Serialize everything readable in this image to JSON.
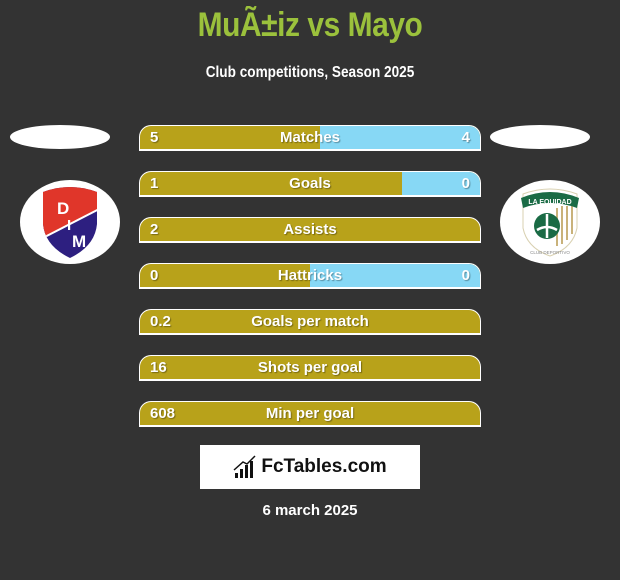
{
  "header": {
    "title": "MuÃ±iz vs Mayo",
    "subtitle": "Club competitions, Season 2025"
  },
  "teams": {
    "left": {
      "name": "DIM",
      "logo_letters": [
        "D",
        "I",
        "M"
      ]
    },
    "right": {
      "name": "La Equidad",
      "logo_text_top": "LA EQUIDAD",
      "logo_text_bottom": "CLUB DEPORTIVO"
    }
  },
  "colors": {
    "left_bar": "#b8a21a",
    "right_bar": "#87d8f5",
    "title": "#9bc13c",
    "background": "#333333"
  },
  "stats": [
    {
      "label": "Matches",
      "left": "5",
      "right": "4",
      "left_share": 0.53
    },
    {
      "label": "Goals",
      "left": "1",
      "right": "0",
      "left_share": 0.77
    },
    {
      "label": "Assists",
      "left": "2",
      "right": "",
      "left_share": 1.0
    },
    {
      "label": "Hattricks",
      "left": "0",
      "right": "0",
      "left_share": 0.5
    },
    {
      "label": "Goals per match",
      "left": "0.2",
      "right": "",
      "left_share": 1.0
    },
    {
      "label": "Shots per goal",
      "left": "16",
      "right": "",
      "left_share": 1.0
    },
    {
      "label": "Min per goal",
      "left": "608",
      "right": "",
      "left_share": 1.0
    }
  ],
  "footer": {
    "brand": "FcTables.com",
    "brand_icon": "bar-chart-icon",
    "date": "6 march 2025"
  }
}
